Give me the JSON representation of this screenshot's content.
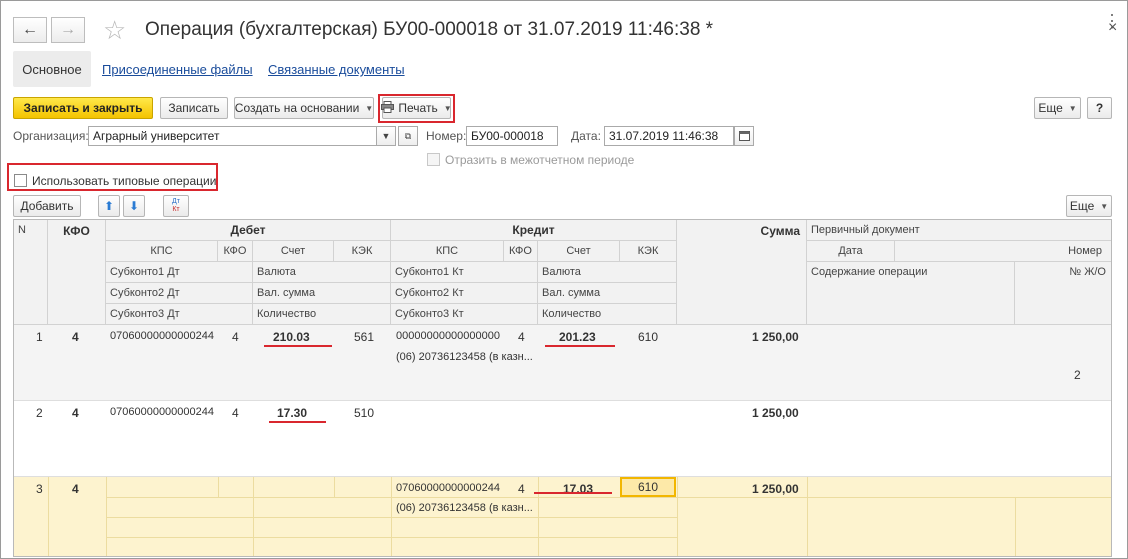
{
  "header": {
    "title": "Операция (бухгалтерская) БУ00-000018 от 31.07.2019 11:46:38 *",
    "back_icon": "arrow-left-icon",
    "forward_icon": "arrow-right-icon",
    "favorite_icon": "star-icon",
    "more_label": "⋮",
    "close_label": "×"
  },
  "nav": {
    "tabs": [
      {
        "label": "Основное",
        "active": true
      },
      {
        "label": "Присоединенные файлы",
        "active": false
      },
      {
        "label": "Связанные документы",
        "active": false
      }
    ]
  },
  "toolbar": {
    "save_close_label": "Записать и закрыть",
    "save_label": "Записать",
    "create_based_label": "Создать на основании",
    "print_label": "Печать",
    "more_label": "Еще",
    "help_label": "?"
  },
  "form": {
    "organization_label": "Организация:",
    "organization_value": "Аграрный университет",
    "number_label": "Номер:",
    "number_value": "БУ00-000018",
    "date_label": "Дата:",
    "date_value": "31.07.2019 11:46:38",
    "interperiod_label": "Отразить в межотчетном периоде",
    "typical_ops_label": "Использовать типовые операции"
  },
  "table_toolbar": {
    "add_label": "Добавить",
    "more_label": "Еще",
    "dt_kt_label_top": "Дт",
    "dt_kt_label_bottom": "Кт"
  },
  "table": {
    "headers": {
      "n": "N",
      "kfo": "КФО",
      "debit": "Дебет",
      "credit": "Кредит",
      "sum": "Сумма",
      "primary_doc": "Первичный документ",
      "kps": "КПС",
      "kfo_sub": "КФО",
      "account": "Счет",
      "kek": "КЭК",
      "date": "Дата",
      "number": "Номер",
      "subkonto1_dt": "Субконто1 Дт",
      "currency": "Валюта",
      "subkonto2_dt": "Субконто2 Дт",
      "cur_sum": "Вал. сумма",
      "subkonto3_dt": "Субконто3 Дт",
      "quantity": "Количество",
      "subkonto1_kt": "Субконто1 Кт",
      "subkonto2_kt": "Субконто2 Кт",
      "subkonto3_kt": "Субконто3 Кт",
      "content": "Содержание операции",
      "journal_no": "№ Ж/О"
    },
    "rows": [
      {
        "n": "1",
        "kfo": "4",
        "dt_kps": "07060000000000244",
        "dt_kfo": "4",
        "dt_account": "210.03",
        "dt_kek": "561",
        "kt_kps": "00000000000000000",
        "kt_kfo": "4",
        "kt_account": "201.23",
        "kt_kek": "610",
        "kt_sub1": "(06) 20736123458 (в казн...",
        "sum": "1 250,00",
        "journal_no": "2"
      },
      {
        "n": "2",
        "kfo": "4",
        "dt_kps": "07060000000000244",
        "dt_kfo": "4",
        "dt_account": "17.30",
        "dt_kek": "510",
        "sum": "1 250,00"
      },
      {
        "n": "3",
        "kfo": "4",
        "kt_kps": "07060000000000244",
        "kt_kfo": "4",
        "kt_account": "17.03",
        "kt_kek": "610",
        "kt_sub1": "(06) 20736123458 (в казн...",
        "sum": "1 250,00"
      }
    ]
  },
  "colors": {
    "accent_yellow": "#f4c300",
    "selected_row": "#fdf3cf",
    "highlight_red": "#d9272e",
    "link_blue": "#1a4c9b"
  }
}
